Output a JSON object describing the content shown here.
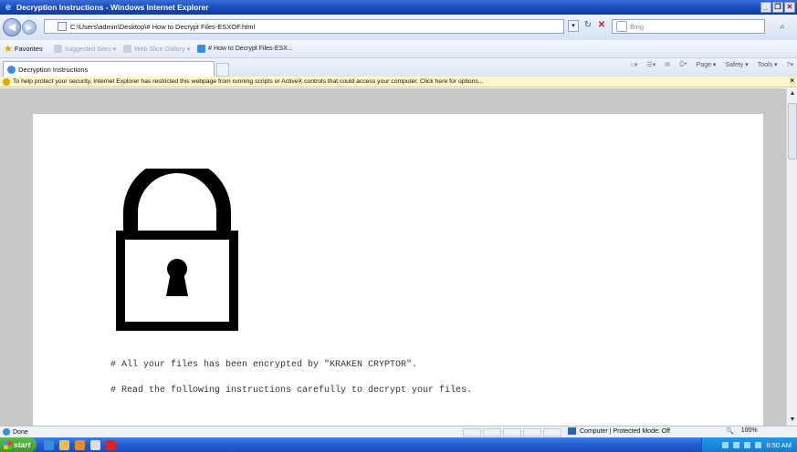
{
  "window": {
    "title": "Decryption Instructions - Windows Internet Explorer",
    "controls": {
      "minimize": "_",
      "maximize": "❐",
      "close": "✕"
    }
  },
  "addressbar": {
    "url": "C:\\Users\\admin\\Desktop\\# How to Decrypt Files-ESXOF.html",
    "search_placeholder": "Bing"
  },
  "favorites": {
    "label": "Favorites",
    "items": [
      {
        "label": "Suggested Sites ▾",
        "active": false
      },
      {
        "label": "Web Slice Gallery ▾",
        "active": false
      },
      {
        "label": "# How to Decrypt Files-ESX...",
        "active": true
      }
    ]
  },
  "tabs": [
    {
      "label": "Decryption Instructions"
    }
  ],
  "commandbar": {
    "items": [
      "Page ▾",
      "Safety ▾",
      "Tools ▾"
    ]
  },
  "infobar": {
    "text": "To help protect your security, Internet Explorer has restricted this webpage from running scripts or ActiveX controls that could access your computer. Click here for options..."
  },
  "page": {
    "line1": "# All your files has been encrypted by \"KRAKEN CRYPTOR\".",
    "line2": "# Read the following instructions carefully to decrypt your files."
  },
  "statusbar": {
    "text": "Done",
    "zone": "Computer | Protected Mode: Off",
    "zoom": "100%"
  },
  "taskbar": {
    "start_label": "start",
    "clock": "6:50 AM"
  },
  "colors": {
    "titlebar": "#1d4fc0",
    "infobar": "#fdf6c8",
    "lock": "#000000"
  }
}
